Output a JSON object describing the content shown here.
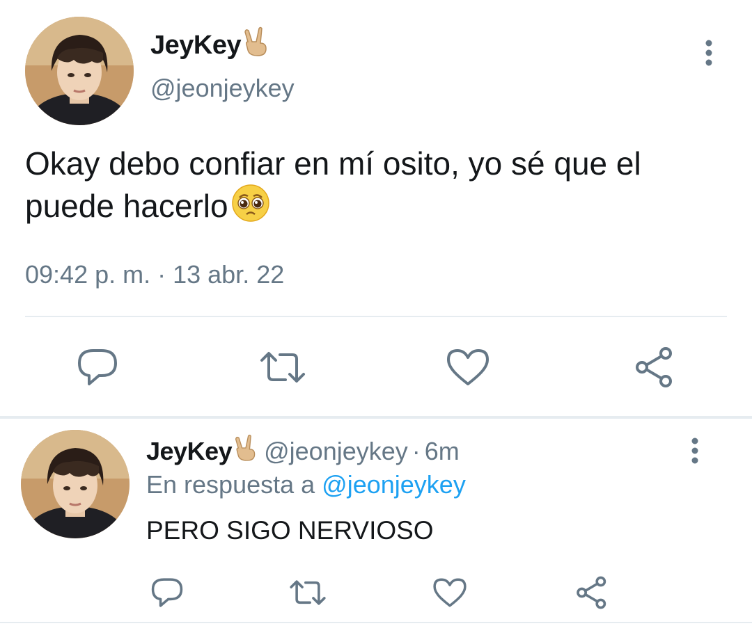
{
  "colors": {
    "text_primary": "#14171a",
    "text_secondary": "#657786",
    "link": "#1da1f2",
    "divider": "#e6ecf0",
    "icon": "#657786"
  },
  "main_tweet": {
    "display_name": "JeyKey",
    "name_emoji": "victory-hand-emoji",
    "handle": "@jeonjeykey",
    "text": "Okay debo confiar en mí osito, yo sé que el puede hacerlo",
    "text_emoji": "pleading-face-emoji",
    "timestamp": "09:42 p. m. · 13 abr. 22",
    "actions": [
      "reply-icon",
      "retweet-icon",
      "like-icon",
      "share-icon"
    ],
    "menu_icon": "more-vertical-icon"
  },
  "reply_tweet": {
    "display_name": "JeyKey",
    "name_emoji": "victory-hand-emoji",
    "handle": "@jeonjeykey",
    "separator": "·",
    "time_ago": "6m",
    "in_reply_to_label": "En respuesta a",
    "in_reply_to_handle": "@jeonjeykey",
    "text": "PERO SIGO NERVIOSO",
    "actions": [
      "reply-icon",
      "retweet-icon",
      "like-icon",
      "share-icon"
    ],
    "menu_icon": "more-vertical-icon"
  }
}
